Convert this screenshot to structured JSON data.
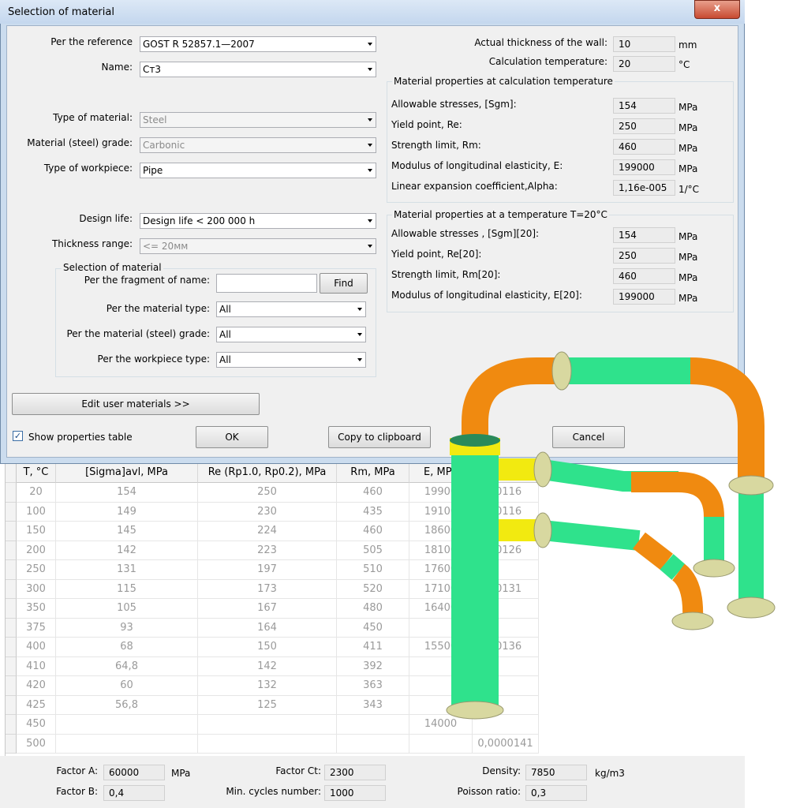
{
  "window": {
    "title": "Selection of material",
    "close_label": "x"
  },
  "form": {
    "reference": {
      "label": "Per the reference",
      "value": "GOST R 52857.1—2007"
    },
    "name": {
      "label": "Name:",
      "value": "Ст3"
    },
    "type_of_material": {
      "label": "Type of material:",
      "value": "Steel"
    },
    "material_grade": {
      "label": "Material (steel) grade:",
      "value": "Carbonic"
    },
    "type_of_workpiece": {
      "label": "Type of workpiece:",
      "value": "Pipe"
    },
    "design_life": {
      "label": "Design life:",
      "value": "Design life < 200 000 h"
    },
    "thickness_range": {
      "label": "Thickness range:",
      "value": "<= 20мм"
    }
  },
  "selection": {
    "title": "Selection of material",
    "fragment_label": "Per the fragment of name:",
    "fragment_value": "",
    "find_label": "Find",
    "material_type_label": "Per the material type:",
    "material_type_value": "All",
    "grade_label": "Per the material (steel) grade:",
    "grade_value": "All",
    "workpiece_label": "Per the workpiece type:",
    "workpiece_value": "All"
  },
  "right": {
    "wall_label": "Actual thickness of the wall:",
    "wall_value": "10",
    "wall_unit": "mm",
    "temp_label": "Calculation temperature:",
    "temp_value": "20",
    "temp_unit": "°C",
    "calc_group_title": "Material properties at calculation temperature",
    "calc_props": [
      {
        "label": "Allowable stresses, [Sgm]:",
        "value": "154",
        "unit": "MPa"
      },
      {
        "label": "Yield point, Re:",
        "value": "250",
        "unit": "MPa"
      },
      {
        "label": "Strength limit, Rm:",
        "value": "460",
        "unit": "MPa"
      },
      {
        "label": "Modulus of longitudinal elasticity, E:",
        "value": "199000",
        "unit": "MPa"
      },
      {
        "label": "Linear expansion coefficient,Alpha:",
        "value": "1,16e-005",
        "unit": "1/°C"
      }
    ],
    "t20_group_title": "Material properties at a temperature T=20°C",
    "t20_props": [
      {
        "label": "Allowable stresses , [Sgm][20]:",
        "value": "154",
        "unit": "MPa"
      },
      {
        "label": "Yield point, Re[20]:",
        "value": "250",
        "unit": "MPa"
      },
      {
        "label": "Strength limit, Rm[20]:",
        "value": "460",
        "unit": "MPa"
      },
      {
        "label": "Modulus of longitudinal elasticity, E[20]:",
        "value": "199000",
        "unit": "MPa"
      }
    ]
  },
  "buttons": {
    "edit_user": "Edit user materials >>",
    "show_table": "Show properties table",
    "show_table_checked": true,
    "ok": "OK",
    "copy": "Copy to clipboard",
    "cancel": "Cancel"
  },
  "table": {
    "headers": [
      "T, °C",
      "[Sigma]avl, MPa",
      "Re (Rp1.0, Rp0.2), MPa",
      "Rm, MPa",
      "E, MPa",
      ""
    ],
    "rows": [
      [
        "20",
        "154",
        "250",
        "460",
        "19900",
        "00116"
      ],
      [
        "100",
        "149",
        "230",
        "435",
        "19100",
        "00116"
      ],
      [
        "150",
        "145",
        "224",
        "460",
        "18600",
        ""
      ],
      [
        "200",
        "142",
        "223",
        "505",
        "18100",
        "00126"
      ],
      [
        "250",
        "131",
        "197",
        "510",
        "17600",
        ""
      ],
      [
        "300",
        "115",
        "173",
        "520",
        "17100",
        "00131"
      ],
      [
        "350",
        "105",
        "167",
        "480",
        "16400",
        ""
      ],
      [
        "375",
        "93",
        "164",
        "450",
        "",
        ""
      ],
      [
        "400",
        "68",
        "150",
        "411",
        "15500",
        "00136"
      ],
      [
        "410",
        "64,8",
        "142",
        "392",
        "",
        ""
      ],
      [
        "420",
        "60",
        "132",
        "363",
        "",
        ""
      ],
      [
        "425",
        "56,8",
        "125",
        "343",
        "",
        ""
      ],
      [
        "450",
        "",
        "",
        "",
        "14000",
        ""
      ],
      [
        "500",
        "",
        "",
        "",
        "",
        "0,0000141"
      ]
    ]
  },
  "footer": {
    "factor_a_label": "Factor A:",
    "factor_a_value": "60000",
    "factor_a_unit": "MPa",
    "factor_b_label": "Factor B:",
    "factor_b_value": "0,4",
    "factor_ct_label": "Factor Ct:",
    "factor_ct_value": "2300",
    "min_cycles_label": "Min. cycles number:",
    "min_cycles_value": "1000",
    "density_label": "Density:",
    "density_value": "7850",
    "density_unit": "kg/m3",
    "poisson_label": "Poisson ratio:",
    "poisson_value": "0,3"
  },
  "colors": {
    "pipe_green": "#2fe28c",
    "pipe_orange": "#f08a10",
    "pipe_yellow": "#f2ea10",
    "flange": "#d8d8a0"
  }
}
